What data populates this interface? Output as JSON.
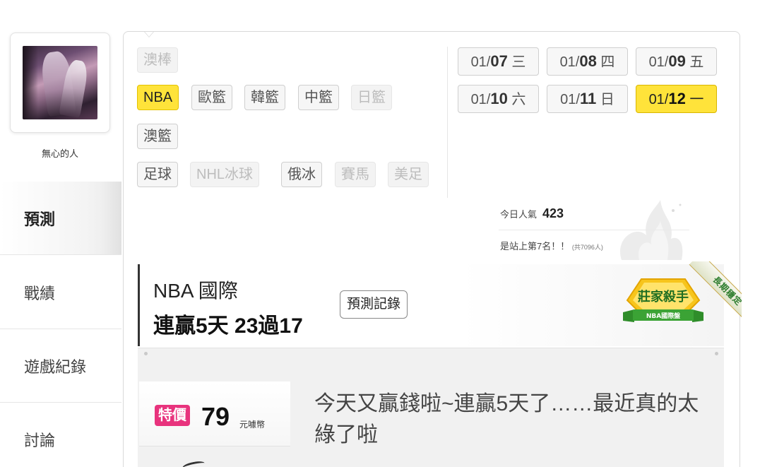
{
  "user": {
    "name": "無心的人"
  },
  "nav": [
    {
      "label": "預測",
      "active": true
    },
    {
      "label": "戰績",
      "active": false
    },
    {
      "label": "遊戲紀錄",
      "active": false
    },
    {
      "label": "討論",
      "active": false
    }
  ],
  "categories": {
    "row1": [
      {
        "label": "澳棒",
        "state": "disabled"
      }
    ],
    "row2": [
      {
        "label": "NBA",
        "state": "active"
      },
      {
        "label": "歐籃",
        "state": "normal"
      },
      {
        "label": "韓籃",
        "state": "normal"
      },
      {
        "label": "中籃",
        "state": "normal"
      },
      {
        "label": "日籃",
        "state": "disabled"
      }
    ],
    "row3": [
      {
        "label": "澳籃",
        "state": "normal"
      }
    ],
    "row4": [
      {
        "label": "足球",
        "state": "normal"
      },
      {
        "label": "NHL冰球",
        "state": "disabled"
      },
      {
        "label": "俄冰",
        "state": "normal"
      },
      {
        "label": "賽馬",
        "state": "disabled"
      },
      {
        "label": "美足",
        "state": "disabled"
      }
    ]
  },
  "dates": [
    {
      "month": "01/",
      "day": "07",
      "weekday": "三",
      "active": false
    },
    {
      "month": "01/",
      "day": "08",
      "weekday": "四",
      "active": false
    },
    {
      "month": "01/",
      "day": "09",
      "weekday": "五",
      "active": false
    },
    {
      "month": "01/",
      "day": "10",
      "weekday": "六",
      "active": false
    },
    {
      "month": "01/",
      "day": "11",
      "weekday": "日",
      "active": false
    },
    {
      "month": "01/",
      "day": "12",
      "weekday": "一",
      "active": true
    }
  ],
  "popularity": {
    "label": "今日人氣",
    "value": "423",
    "rank_text": "是站上第7名！！",
    "rank_total": "(共7096人)"
  },
  "record": {
    "league": "NBA 國際",
    "streak": "連贏5天 23過17",
    "history_button": "預測記錄"
  },
  "badge": {
    "title": "莊家殺手",
    "subtitle": "NBA國際盤",
    "ribbon": "長期穩定"
  },
  "offer": {
    "sale_label": "特價",
    "price": "79",
    "currency": "元噱幣",
    "description": "今天又贏錢啦~連贏5天了……最近真的太綠了啦"
  },
  "colors": {
    "active_yellow": "#ffe33a",
    "sale_pink": "#e8337d",
    "badge_green": "#3a8f2e",
    "badge_gold": "#e8b800"
  }
}
